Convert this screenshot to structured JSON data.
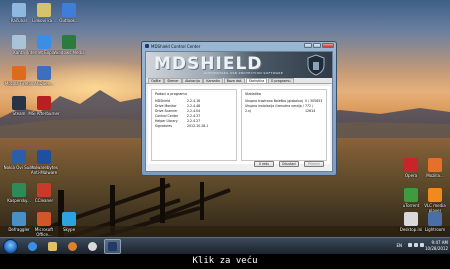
{
  "desktop": {
    "left_icons": [
      {
        "label": "Računar",
        "color": "#8fb8e0"
      },
      {
        "label": "Linkovi ka...",
        "color": "#d7c36b"
      },
      {
        "label": "Outlook...",
        "color": "#3f7ed8"
      },
      {
        "label": "Kanta",
        "color": "#a9c4d8"
      },
      {
        "label": "Internet Explorer",
        "color": "#3a8ee6"
      },
      {
        "label": "Windows Media",
        "color": "#2c7a3e"
      },
      {
        "label": "Mozilla Firefox",
        "color": "#e06a1b"
      },
      {
        "label": "ACDSee...",
        "color": "#3e6fbf"
      },
      {
        "label": "Steam",
        "color": "#263446"
      },
      {
        "label": "MSI Afterburner",
        "color": "#b52020"
      },
      {
        "label": "Nokia Ovi Suite",
        "color": "#2a5fa8"
      },
      {
        "label": "Malwarebytes Anti-Malware",
        "color": "#1f4f9e"
      },
      {
        "label": "Kaspersky...",
        "color": "#2e8b57"
      },
      {
        "label": "CCleaner",
        "color": "#c93a2b"
      },
      {
        "label": "Defraggler",
        "color": "#4a90c8"
      },
      {
        "label": "Microsoft Office...",
        "color": "#d3552a"
      },
      {
        "label": "Skype",
        "color": "#2aa3e0"
      }
    ],
    "right_icons": [
      {
        "label": "Opera",
        "color": "#c8242c"
      },
      {
        "label": "Mozilla...",
        "color": "#e5702a"
      },
      {
        "label": "uTorrent",
        "color": "#3f9b3f"
      },
      {
        "label": "VLC media player",
        "color": "#f08a1c"
      },
      {
        "label": "Desktop.ini",
        "color": "#d9d9d9"
      },
      {
        "label": "Lightroom",
        "color": "#4a6fa8"
      }
    ]
  },
  "window": {
    "title": "MDShield Control Center",
    "banner_word": "MDSHIELD",
    "banner_tagline": "AUTOMATSKA USB PROTECTION SOFTWARE",
    "tabs": [
      {
        "label": "Opšte",
        "active": false
      },
      {
        "label": "Skener",
        "active": false
      },
      {
        "label": "Alokacija",
        "active": false
      },
      {
        "label": "Karantin",
        "active": false
      },
      {
        "label": "Baza dat.",
        "active": false
      },
      {
        "label": "Statistika",
        "active": true
      },
      {
        "label": "O programu",
        "active": false
      }
    ],
    "left_pane": {
      "title": "Podaci o programu",
      "rows": [
        {
          "k": "MDShield",
          "v": "2.2.4.16"
        },
        {
          "k": "Drive Monitor",
          "v": "2.2.4.48"
        },
        {
          "k": "Drive Scanner",
          "v": "2.2.4.04"
        },
        {
          "k": "Control Center",
          "v": "2.2.4.37"
        },
        {
          "k": "Helper Library",
          "v": "2.2.4.27"
        },
        {
          "k": "Signatures",
          "v": "2012.10.28.1"
        }
      ]
    },
    "right_pane": {
      "title": "Statistika",
      "rows": [
        {
          "k": "Ukupno trostrano Baleško (globalno)",
          "v": "0 / 305653"
        },
        {
          "k": "Ukupno instalacija (trenutna verzija / 2.x)",
          "v": "772 / 12614"
        }
      ]
    },
    "buttons": {
      "refresh": "U redu",
      "cancel": "Odustani",
      "apply": "Primeni"
    }
  },
  "taskbar": {
    "language": "EN",
    "time": "9:47 AM",
    "date": "10/28/2012"
  },
  "caption": "Klik za veću"
}
